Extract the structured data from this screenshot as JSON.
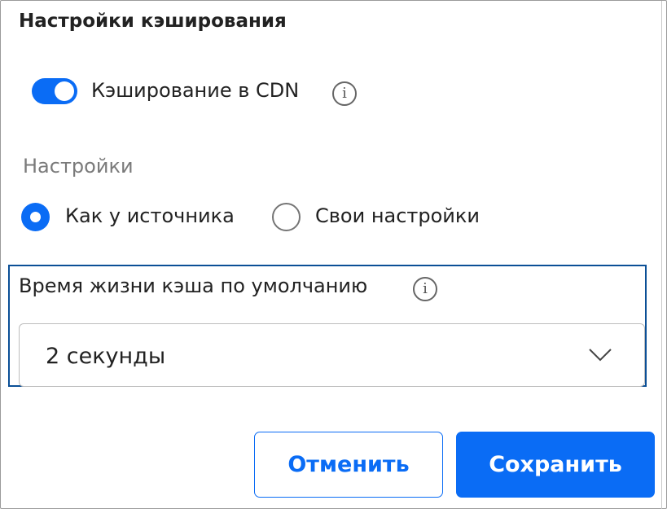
{
  "dialog": {
    "title": "Настройки кэширования"
  },
  "cdn_toggle": {
    "label": "Кэширование в CDN",
    "enabled": true,
    "info_icon": "info-icon"
  },
  "settings": {
    "section_label": "Настройки",
    "options": [
      {
        "label": "Как у источника",
        "selected": true
      },
      {
        "label": "Свои настройки",
        "selected": false
      }
    ]
  },
  "ttl": {
    "label": "Время жизни кэша по умолчанию",
    "info_icon": "info-icon",
    "selected_value": "2 секунды",
    "dropdown_icon": "chevron-down-icon"
  },
  "buttons": {
    "cancel_label": "Отменить",
    "save_label": "Сохранить"
  },
  "colors": {
    "accent": "#0a6cf5",
    "focus_border": "#0b4f96",
    "muted_text": "#7a7a7a"
  }
}
